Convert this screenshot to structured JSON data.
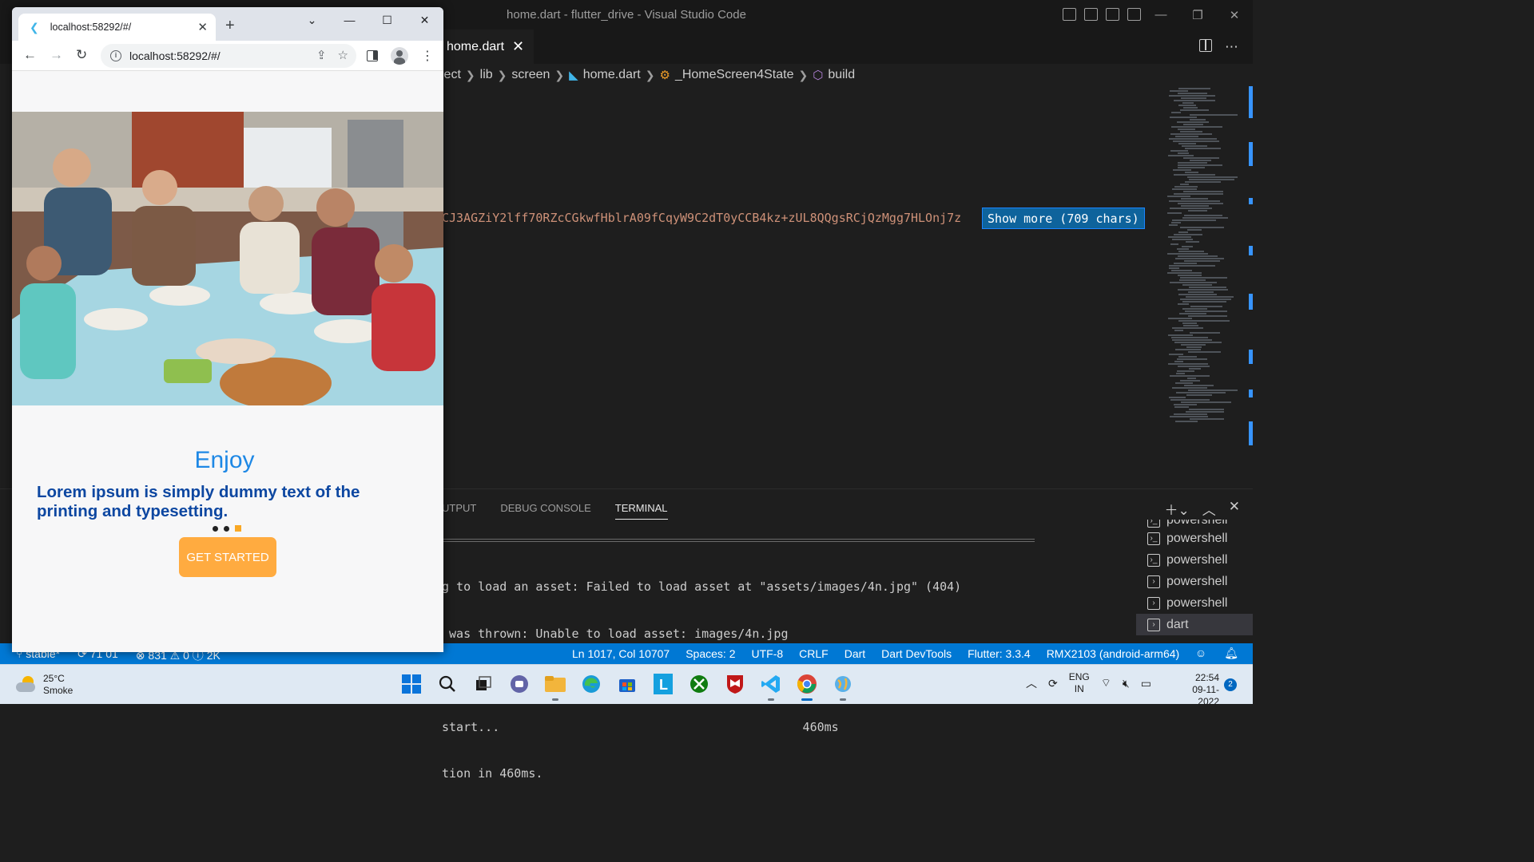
{
  "vscode": {
    "window_title": "home.dart - flutter_drive - Visual Studio Code",
    "tab": {
      "label": "home.dart",
      "close": "✕"
    },
    "breadcrumb": [
      "ject",
      "lib",
      "screen",
      "home.dart",
      "_HomeScreen4State",
      "build"
    ],
    "editor": {
      "code_text": "CJ3AGZiY2lff70RZcCGkwfHblrA09fCqyW9C2dT0yCCB4kz+zUL8QQgsRCjQzMgg7HLOnj7z",
      "show_more_label": "Show more (709 chars)"
    },
    "panel": {
      "tabs": [
        "UTPUT",
        "DEBUG CONSOLE",
        "TERMINAL"
      ],
      "active_tab": "TERMINAL",
      "terminal_lines": [
        "g to load an asset: Failed to load asset at \"assets/images/4n.jpg\" (404)",
        " was thrown: Unable to load asset: images/4n.jpg",
        "",
        "start...                                          460ms",
        "tion in 460ms."
      ],
      "terminals": [
        "powershell",
        "powershell",
        "powershell",
        "powershell",
        "powershell",
        "dart"
      ],
      "active_terminal": "dart"
    },
    "status": {
      "branch": "stable*",
      "sync": "71 01",
      "problems": "831",
      "warnings": "0",
      "info": "2K",
      "position": "Ln 1017, Col 10707",
      "spaces": "Spaces: 2",
      "encoding": "UTF-8",
      "eol": "CRLF",
      "language": "Dart",
      "devtools": "Dart DevTools",
      "flutter": "Flutter: 3.3.4",
      "device": "RMX2103 (android-arm64)"
    }
  },
  "chrome": {
    "tab_title": "localhost:58292/#/",
    "url": "localhost:58292/#/",
    "page": {
      "heading": "Enjoy",
      "description": "Lorem ipsum is simply dummy text of the printing and typesetting.",
      "page_count": 3,
      "active_page": 3,
      "button_label": "GET STARTED",
      "accent_color": "#ffab40",
      "heading_color": "#1e88e5"
    }
  },
  "taskbar": {
    "weather_temp": "25°C",
    "weather_desc": "Smoke",
    "lang_top": "ENG",
    "lang_bottom": "IN",
    "time": "22:54",
    "date": "09-11-2022",
    "notifications": "2"
  }
}
